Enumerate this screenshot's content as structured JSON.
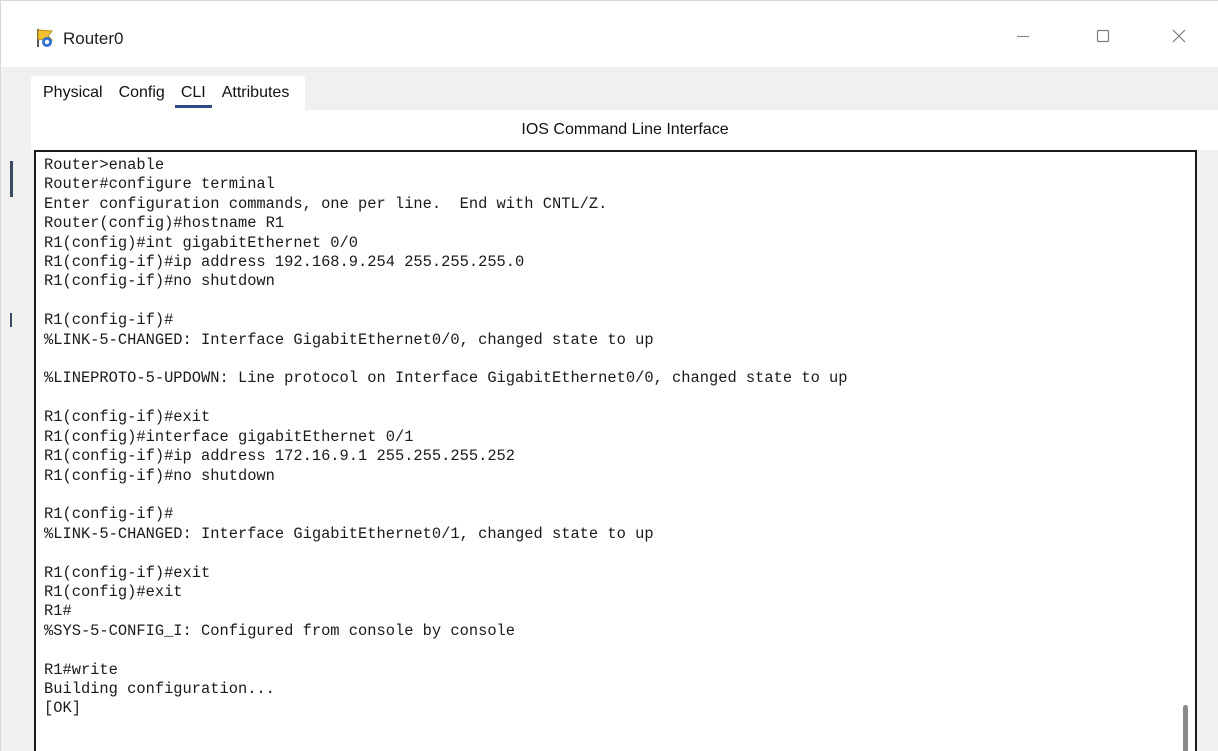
{
  "window": {
    "title": "Router0"
  },
  "tabs": [
    {
      "label": "Physical"
    },
    {
      "label": "Config"
    },
    {
      "label": "CLI"
    },
    {
      "label": "Attributes"
    }
  ],
  "active_tab": "CLI",
  "cli": {
    "header": "IOS Command Line Interface",
    "lines": [
      "Router>enable",
      "Router#configure terminal",
      "Enter configuration commands, one per line.  End with CNTL/Z.",
      "Router(config)#hostname R1",
      "R1(config)#int gigabitEthernet 0/0",
      "R1(config-if)#ip address 192.168.9.254 255.255.255.0",
      "R1(config-if)#no shutdown",
      "",
      "R1(config-if)#",
      "%LINK-5-CHANGED: Interface GigabitEthernet0/0, changed state to up",
      "",
      "%LINEPROTO-5-UPDOWN: Line protocol on Interface GigabitEthernet0/0, changed state to up",
      "",
      "R1(config-if)#exit",
      "R1(config)#interface gigabitEthernet 0/1",
      "R1(config-if)#ip address 172.16.9.1 255.255.255.252",
      "R1(config-if)#no shutdown",
      "",
      "R1(config-if)#",
      "%LINK-5-CHANGED: Interface GigabitEthernet0/1, changed state to up",
      "",
      "R1(config-if)#exit",
      "R1(config)#exit",
      "R1#",
      "%SYS-5-CONFIG_I: Configured from console by console",
      "",
      "R1#write",
      "Building configuration...",
      "[OK]"
    ]
  },
  "icons": {
    "app": "router-app-icon",
    "minimize": "minimize-icon",
    "maximize": "maximize-icon",
    "close": "close-icon"
  },
  "colors": {
    "tab_underline": "#2e4a82",
    "terminal_border": "#1a1a1a",
    "window_background": "#f0f0f0"
  }
}
